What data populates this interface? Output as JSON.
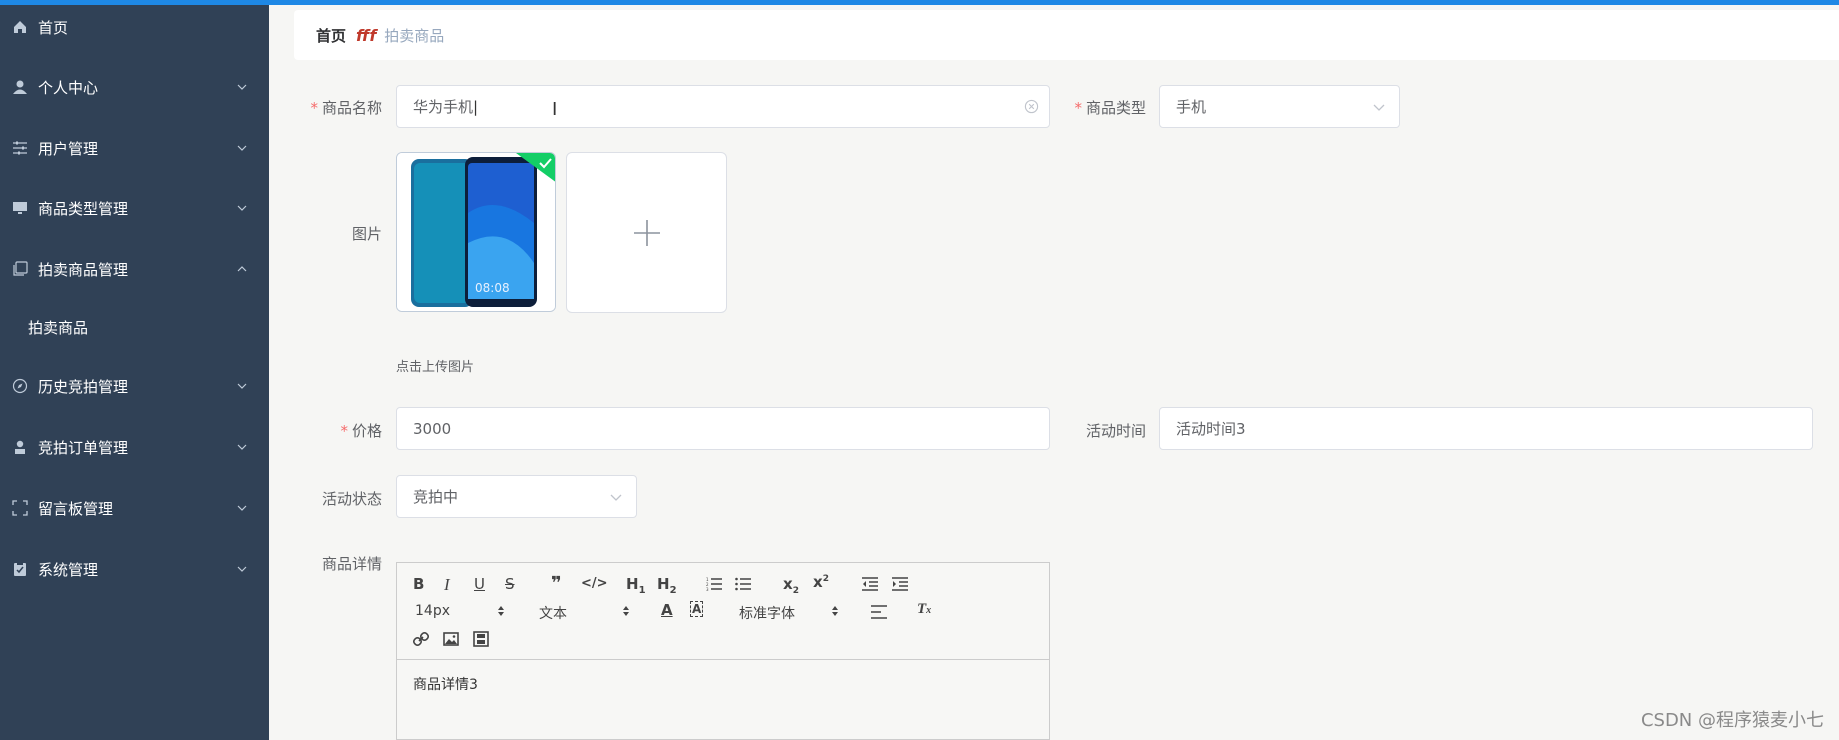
{
  "colors": {
    "accent": "#1e88e5",
    "sidebar": "#304156",
    "required": "#f56c6c",
    "success": "#13ce66"
  },
  "sidebar": {
    "items": [
      {
        "label": "首页",
        "icon": "home-icon"
      },
      {
        "label": "个人中心",
        "icon": "user-icon"
      },
      {
        "label": "用户管理",
        "icon": "sliders-icon"
      },
      {
        "label": "商品类型管理",
        "icon": "monitor-icon"
      },
      {
        "label": "拍卖商品管理",
        "icon": "copy-icon"
      },
      {
        "label": "历史竞拍管理",
        "icon": "compass-icon"
      },
      {
        "label": "竞拍订单管理",
        "icon": "person-icon"
      },
      {
        "label": "留言板管理",
        "icon": "fullscreen-icon"
      },
      {
        "label": "系统管理",
        "icon": "clipboard-icon"
      }
    ],
    "sub_item": "拍卖商品"
  },
  "breadcrumb": {
    "home": "首页",
    "separator": "fff",
    "current": "拍卖商品"
  },
  "form": {
    "name_label": "商品名称",
    "name_value": "华为手机",
    "type_label": "商品类型",
    "type_value": "手机",
    "image_label": "图片",
    "upload_tip": "点击上传图片",
    "price_label": "价格",
    "price_value": "3000",
    "time_label": "活动时间",
    "time_value": "活动时间3",
    "status_label": "活动状态",
    "status_value": "竞拍中",
    "detail_label": "商品详情"
  },
  "editor": {
    "font_size": "14px",
    "header_type": "文本",
    "font_family": "标准字体",
    "content": "商品详情3"
  },
  "thumb_clock": "08:08",
  "watermark": "CSDN @程序猿麦小七"
}
